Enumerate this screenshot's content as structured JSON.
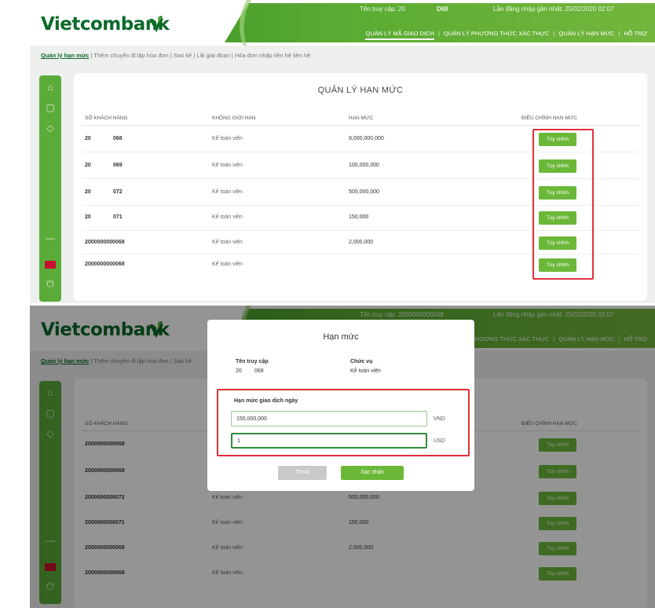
{
  "app": {
    "brand": "Vietcombank",
    "header_info_left": "Tên truy cập: 20",
    "header_info_mid": "D68",
    "header_info_right": "Lần đăng nhập gần nhất: 25/02/2020 02:07",
    "header_info_left_2": "Tên truy cập: 2000000000068",
    "header_info_right_2": "Lần đăng nhập gần nhất: 25/02/2020 02:07",
    "nav": [
      {
        "label": "QUẢN LÝ MÃ GIAO DỊCH"
      },
      {
        "label": "QUẢN LÝ PHƯƠNG THỨC XÁC THỰC"
      },
      {
        "label": "QUẢN LÝ HẠN MỨC"
      },
      {
        "label": "HỖ TRỢ"
      }
    ],
    "nav_short": [
      {
        "label": "PHƯƠNG THỨC XÁC THỰC"
      },
      {
        "label": "QUẢN LÝ HẠN MỨC"
      },
      {
        "label": "HỖ TRỢ"
      }
    ],
    "breadcrumb": [
      "Quản lý hạn mức",
      "Thêm chuyển đi lập hóa đơn",
      "Sao kê",
      "Lãi giai đoạn",
      "Hóa đơn nhập liên hệ liên hệ"
    ]
  },
  "page": {
    "title": "QUẢN LÝ HẠN MỨC",
    "columns": [
      "SỐ KHÁCH HÀNG",
      "KHÔNG GIỚI HẠN",
      "HẠN MỨC",
      "ĐIỀU CHỈNH HẠN MỨC"
    ],
    "rows": [
      {
        "account": "20",
        "code": "068",
        "type": "Kế toán viên",
        "limit": "9,000,000,000",
        "action": "Tùy chỉnh"
      },
      {
        "account": "20",
        "code": "069",
        "type": "Kế toán viên",
        "limit": "100,000,000",
        "action": "Tùy chỉnh"
      },
      {
        "account": "20",
        "code": "072",
        "type": "Kế toán viên",
        "limit": "500,000,000",
        "action": "Tùy chỉnh"
      },
      {
        "account": "20",
        "code": "071",
        "type": "Kế toán viên",
        "limit": "150,000",
        "action": "Tùy chỉnh"
      },
      {
        "account": "2000000000068",
        "code": "",
        "type": "Kế toán viên",
        "limit": "2,000,000",
        "action": "Tùy chỉnh"
      },
      {
        "account": "2000000000068",
        "code": "",
        "type": "Kế toán viên",
        "limit": "",
        "action": "Tùy chỉnh"
      }
    ],
    "rows_2": [
      {
        "account": "2000000000068",
        "type": "",
        "limit": "",
        "action": "Tùy chỉnh"
      },
      {
        "account": "2000000000069",
        "type": "",
        "limit": "",
        "action": "Tùy chỉnh"
      },
      {
        "account": "2000000000072",
        "type": "Kế toán viên",
        "limit": "500,000,000",
        "action": "Tùy chỉnh"
      },
      {
        "account": "2000000000071",
        "type": "Kế toán viên",
        "limit": "150,000",
        "action": "Tùy chỉnh"
      },
      {
        "account": "2000000000068",
        "type": "Kế toán viên",
        "limit": "2,000,000",
        "action": "Tùy chỉnh"
      },
      {
        "account": "2000000000068",
        "type": "Kế toán viên",
        "limit": "",
        "action": "Tùy chỉnh"
      }
    ]
  },
  "modal": {
    "title": "Hạn mức",
    "label_user": "Tên truy cập",
    "label_role": "Chức vụ",
    "user_prefix": "20",
    "user_code": "068",
    "role": "Kế toán viên",
    "section_label": "Hạn mức giao dịch ngày",
    "input1_value": "150,000,000",
    "input1_unit": "VND",
    "input2_value": "1",
    "input2_unit": "USD",
    "close_label": "Thoát",
    "confirm_label": "Xác nhận"
  },
  "colors": {
    "brand_green": "#0c6a2a",
    "accent_green": "#6bb839",
    "highlight_red": "#e0303a"
  }
}
